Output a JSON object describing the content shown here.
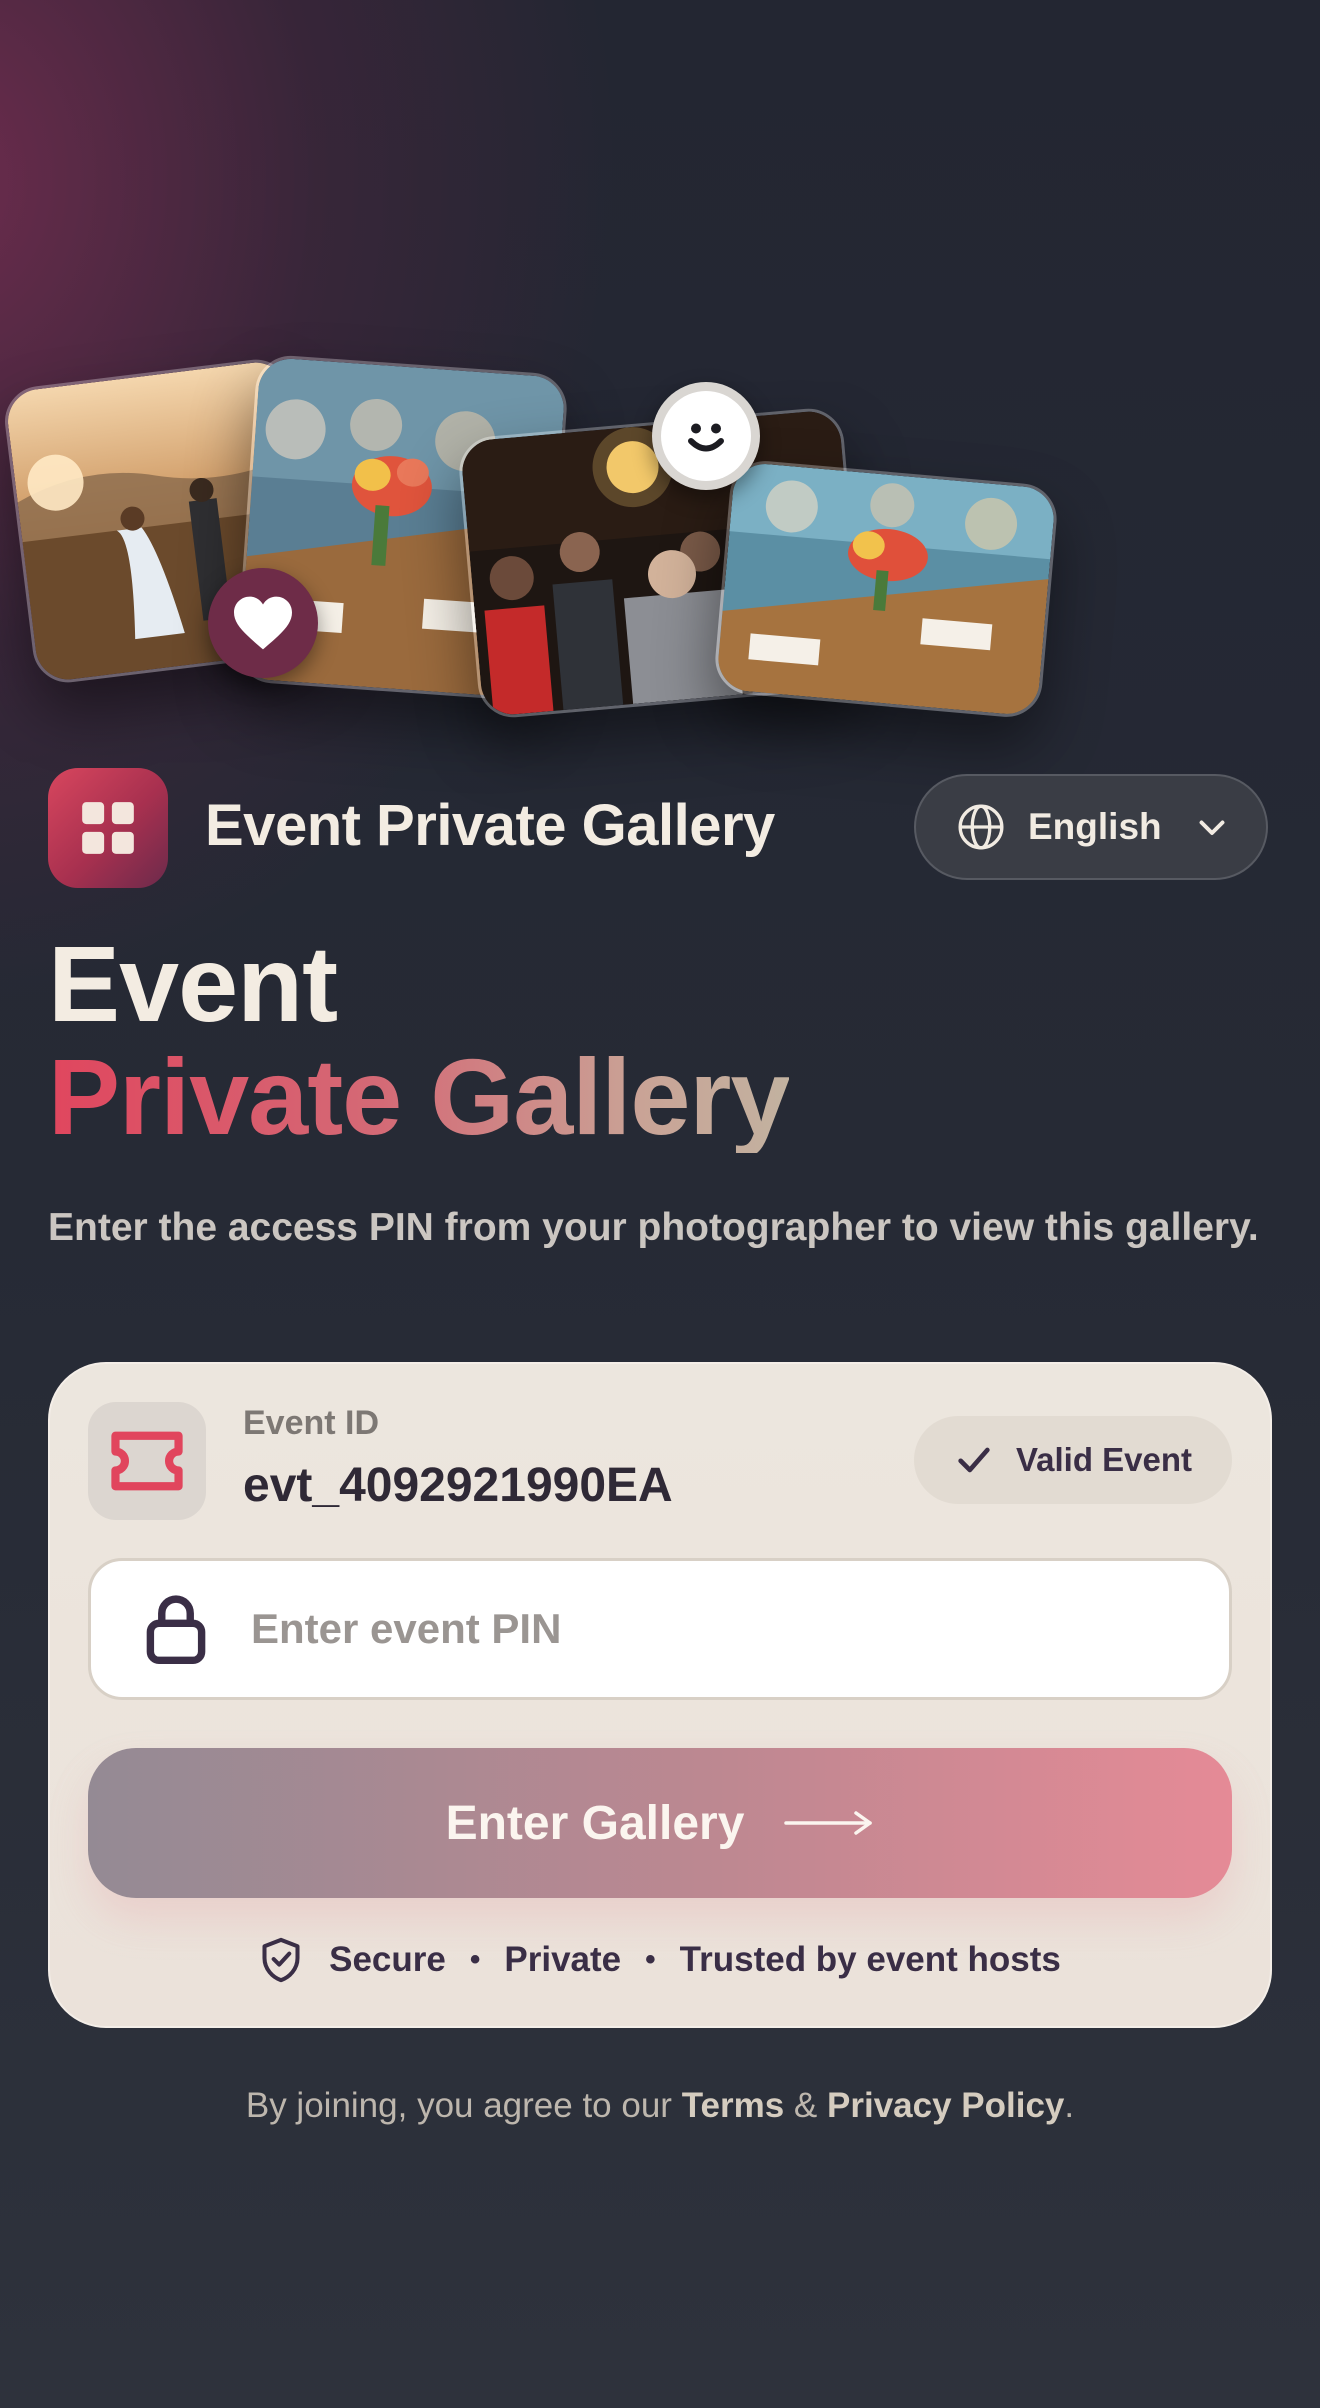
{
  "header": {
    "app_title": "Event Private Gallery",
    "language_label": "English"
  },
  "hero": {
    "line1": "Event",
    "line2": "Private Gallery",
    "subtitle": "Enter the access PIN from your photographer to view this gallery."
  },
  "card": {
    "event_id_label": "Event ID",
    "event_id_value": "evt_4092921990EA",
    "valid_badge_label": "Valid Event",
    "pin_placeholder": "Enter event PIN",
    "enter_button_label": "Enter Gallery",
    "trust_items": [
      "Secure",
      "Private",
      "Trusted by event hosts"
    ],
    "trust_separator": "•"
  },
  "footer": {
    "prefix": "By joining, you agree to our",
    "terms_label": "Terms",
    "ampersand": "&",
    "privacy_label": "Privacy Policy",
    "suffix": "."
  },
  "icons": {
    "app_logo": "grid-icon",
    "language": "globe-icon",
    "dropdown": "chevron-down-icon",
    "event": "ticket-icon",
    "valid": "check-icon",
    "pin": "lock-icon",
    "enter": "arrow-right-icon",
    "trust": "shield-check-icon",
    "heart_badge": "heart-icon",
    "smile_badge": "smile-icon"
  },
  "colors": {
    "accent": "#e0465e",
    "background": "#262a35",
    "card": "#ece6de",
    "text_dark": "#2f2936"
  }
}
